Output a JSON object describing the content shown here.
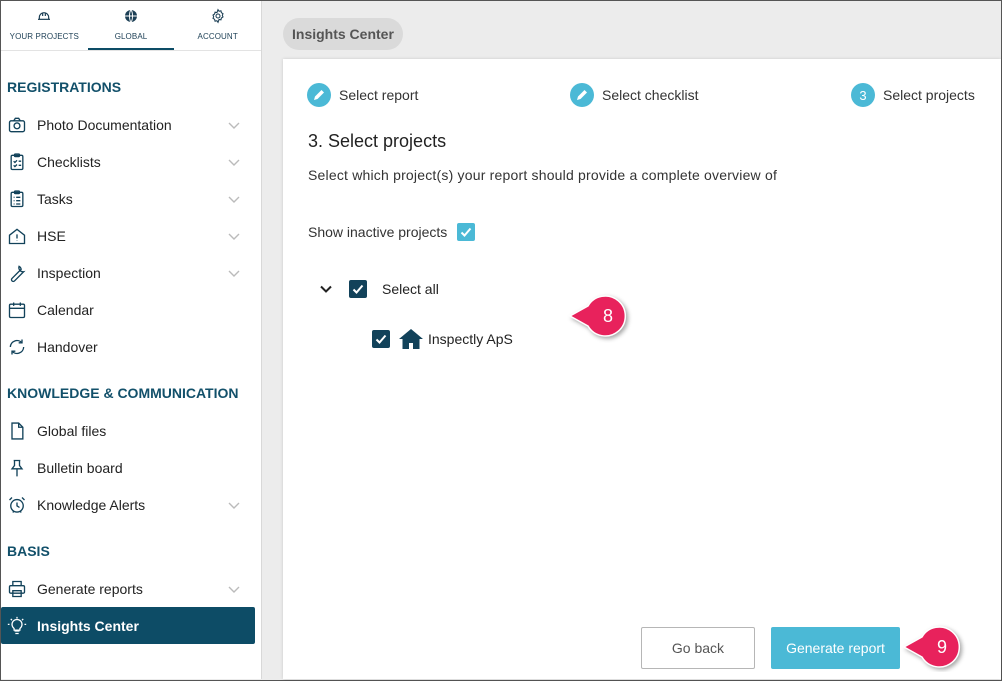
{
  "topnav": {
    "tabs": [
      {
        "label": "YOUR PROJECTS",
        "icon": "hard-hat-icon"
      },
      {
        "label": "GLOBAL",
        "icon": "globe-icon",
        "active": true
      },
      {
        "label": "ACCOUNT",
        "icon": "gear-icon"
      }
    ]
  },
  "sidebar": {
    "sections": [
      {
        "title": "REGISTRATIONS"
      },
      {
        "title": "KNOWLEDGE & COMMUNICATION"
      },
      {
        "title": "BASIS"
      }
    ],
    "items": [
      {
        "label": "Photo Documentation",
        "icon": "camera-icon",
        "expandable": true
      },
      {
        "label": "Checklists",
        "icon": "clipboard-check-icon",
        "expandable": true
      },
      {
        "label": "Tasks",
        "icon": "clipboard-list-icon",
        "expandable": true
      },
      {
        "label": "HSE",
        "icon": "house-warning-icon",
        "expandable": true
      },
      {
        "label": "Inspection",
        "icon": "wrench-icon",
        "expandable": true
      },
      {
        "label": "Calendar",
        "icon": "calendar-icon",
        "expandable": false
      },
      {
        "label": "Handover",
        "icon": "sync-icon",
        "expandable": false
      },
      {
        "label": "Global files",
        "icon": "file-icon",
        "expandable": false
      },
      {
        "label": "Bulletin board",
        "icon": "pin-icon",
        "expandable": false
      },
      {
        "label": "Knowledge Alerts",
        "icon": "alarm-clock-icon",
        "expandable": true
      },
      {
        "label": "Generate reports",
        "icon": "printer-icon",
        "expandable": true
      },
      {
        "label": "Insights Center",
        "icon": "lightbulb-icon",
        "expandable": false,
        "active": true
      }
    ]
  },
  "breadcrumb": "Insights Center",
  "wizard": {
    "steps": [
      {
        "label": "Select report",
        "state": "done"
      },
      {
        "label": "Select checklist",
        "state": "done"
      },
      {
        "number": "3",
        "label": "Select projects",
        "state": "current"
      }
    ],
    "heading": "3. Select projects",
    "description": "Select which project(s) your report should provide a complete overview of",
    "show_inactive_label": "Show inactive projects",
    "show_inactive_checked": true,
    "select_all_label": "Select all",
    "select_all_checked": true,
    "projects": [
      {
        "name": "Inspectly ApS",
        "checked": true,
        "icon": "home-icon"
      }
    ],
    "back_label": "Go back",
    "generate_label": "Generate report"
  },
  "annotations": [
    {
      "number": "8"
    },
    {
      "number": "9"
    }
  ],
  "colors": {
    "primary_dark": "#0d4c66",
    "accent": "#4bb9d6",
    "marker": "#e8225c"
  }
}
